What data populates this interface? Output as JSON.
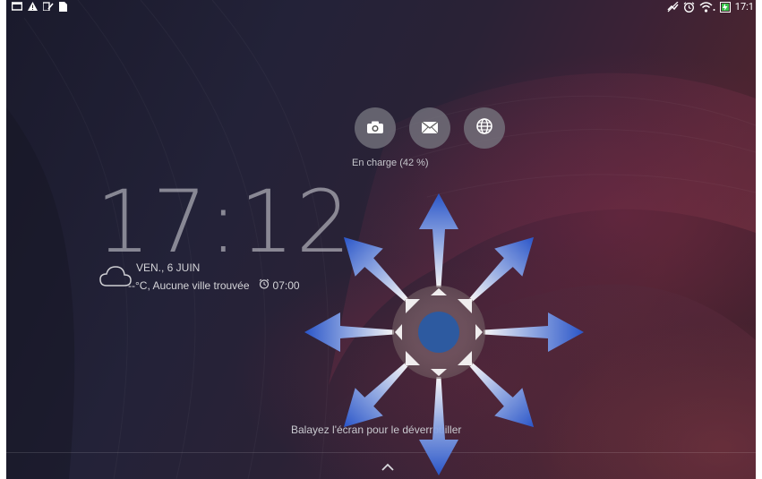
{
  "status_bar": {
    "left_icons": [
      "screen-icon",
      "warning-icon",
      "edit-icon",
      "file-icon"
    ],
    "right_icons": [
      "mute-icon",
      "alarm-icon",
      "wifi-icon",
      "battery-charging-icon"
    ],
    "time": "17:1"
  },
  "shortcuts": [
    {
      "name": "camera-icon"
    },
    {
      "name": "mail-icon"
    },
    {
      "name": "globe-icon"
    }
  ],
  "charging_text": "En charge (42 %)",
  "clock": {
    "time": "17:12",
    "date": "VEN., 6 JUIN",
    "weather": "--°C, Aucune ville trouvée",
    "alarm": "07:00"
  },
  "swipe_hint": "Balayez l'écran pour le déverrouiller",
  "gesture_overlay": {
    "center_color": "#2d5aa0",
    "arrow_color": "#3a66d0",
    "directions": [
      "up",
      "up-right",
      "right",
      "down-right",
      "down",
      "down-left",
      "left",
      "up-left"
    ]
  }
}
